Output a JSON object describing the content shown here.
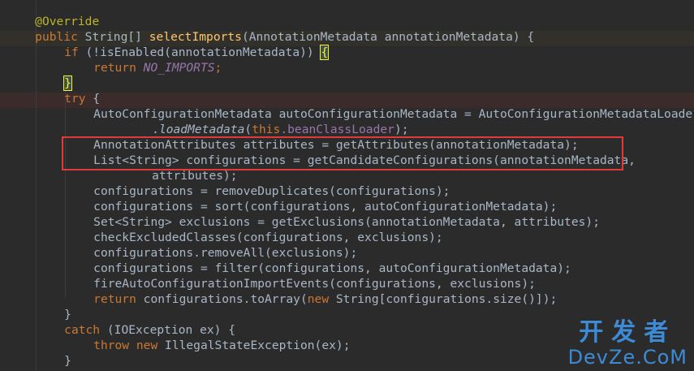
{
  "code": {
    "l0": {
      "annotation": "@Override"
    },
    "l1": {
      "kw_public": "public",
      "type": " String[] ",
      "method": "selectImports",
      "params": "(AnnotationMetadata annotationMetadata) {"
    },
    "l2": {
      "kw_if": "if",
      "expr": " (!isEnabled(annotationMetadata)) ",
      "brace": "{"
    },
    "l3": {
      "kw_return": "return",
      "sp": " ",
      "constant": "NO_IMPORTS",
      "semi": ";"
    },
    "l4": {
      "brace": "}"
    },
    "l5": {
      "kw_try": "try",
      "rest": " {"
    },
    "l6": {
      "text": "AutoConfigurationMetadata autoConfigurationMetadata = AutoConfigurationMetadataLoader"
    },
    "l7": {
      "dot": ".",
      "call": "loadMetadata",
      "open": "(",
      "kw_this": "this",
      "field": ".beanClassLoader",
      "close": ");"
    },
    "l8": {
      "text": "AnnotationAttributes attributes = getAttributes(annotationMetadata);"
    },
    "l9": {
      "text": "List<String> configurations = getCandidateConfigurations(annotationMetadata,"
    },
    "l10": {
      "text": "attributes);"
    },
    "l11": {
      "text": "configurations = removeDuplicates(configurations);"
    },
    "l12": {
      "text": "configurations = sort(configurations, autoConfigurationMetadata);"
    },
    "l13": {
      "text": "Set<String> exclusions = getExclusions(annotationMetadata, attributes);"
    },
    "l14": {
      "text": "checkExcludedClasses(configurations, exclusions);"
    },
    "l15": {
      "text": "configurations.removeAll(exclusions);"
    },
    "l16": {
      "text": "configurations = filter(configurations, autoConfigurationMetadata);"
    },
    "l17": {
      "text": "fireAutoConfigurationImportEvents(configurations, exclusions);"
    },
    "l18": {
      "kw_return": "return",
      "mid": " configurations.toArray(",
      "kw_new": "new",
      "rest": " String[configurations.size()]);"
    },
    "l19": {
      "brace": "}"
    },
    "l20": {
      "kw_catch": "catch",
      "rest": " (IOException ex) {"
    },
    "l21": {
      "kw_throw": "throw",
      "sp": " ",
      "kw_new": "new",
      "rest": " IllegalStateException(ex);"
    },
    "l22": {
      "brace": "}"
    },
    "l23": {
      "brace": "}"
    }
  },
  "watermark": {
    "top": "开发者",
    "bottom": "DevZe.CoM"
  },
  "colors": {
    "background": "#2b2b2b",
    "keyword": "#cc7832",
    "annotation": "#bbb529",
    "method": "#ffc66d",
    "constant": "#9876aa",
    "highlight_box": "#e03a3a",
    "watermark": "#3d8bd6"
  }
}
